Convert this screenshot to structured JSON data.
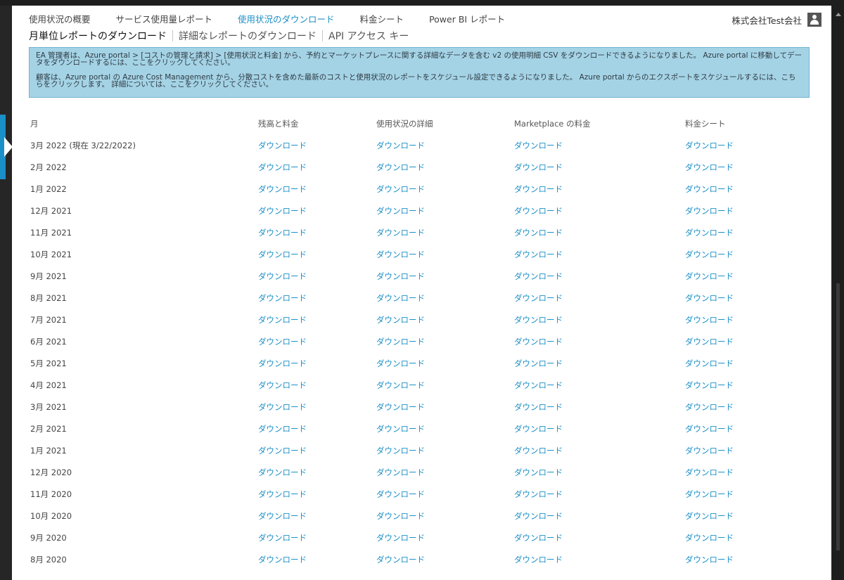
{
  "nav": {
    "items": [
      {
        "label": "使用状況の概要",
        "active": false
      },
      {
        "label": "サービス使用量レポート",
        "active": false
      },
      {
        "label": "使用状況のダウンロード",
        "active": true
      },
      {
        "label": "料金シート",
        "active": false
      },
      {
        "label": "Power BI レポート",
        "active": false
      }
    ]
  },
  "org": {
    "name": "株式会社Test会社",
    "icon": "user-icon"
  },
  "subnav": {
    "items": [
      {
        "label": "月単位レポートのダウンロード",
        "active": true
      },
      {
        "label": "詳細なレポートのダウンロード",
        "active": false
      },
      {
        "label": "API アクセス キー",
        "active": false
      }
    ]
  },
  "notice": {
    "line1": "EA 管理者は、Azure portal > [コストの管理と請求] > [使用状況と料金] から、予約とマーケットプレースに関する詳細なデータを含む v2 の使用明細 CSV をダウンロードできるようになりました。 Azure portal に移動してデータをダウンロードするには、ここをクリックしてください。",
    "line2": "顧客は、Azure portal の Azure Cost Management から、分散コストを含めた最新のコストと使用状況のレポートをスケジュール設定できるようになりました。 Azure portal からのエクスポートをスケジュールするには、こちらをクリックします。 詳細については、ここをクリックしてください。"
  },
  "table": {
    "headers": [
      "月",
      "残高と料金",
      "使用状況の詳細",
      "Marketplace の料金",
      "料金シート"
    ],
    "link_label": "ダウンロード",
    "rows": [
      "3月 2022 (現在 3/22/2022)",
      "2月 2022",
      "1月 2022",
      "12月 2021",
      "11月 2021",
      "10月 2021",
      "9月 2021",
      "8月 2021",
      "7月 2021",
      "6月 2021",
      "5月 2021",
      "4月 2021",
      "3月 2021",
      "2月 2021",
      "1月 2021",
      "12月 2020",
      "11月 2020",
      "10月 2020",
      "9月 2020",
      "8月 2020"
    ]
  }
}
